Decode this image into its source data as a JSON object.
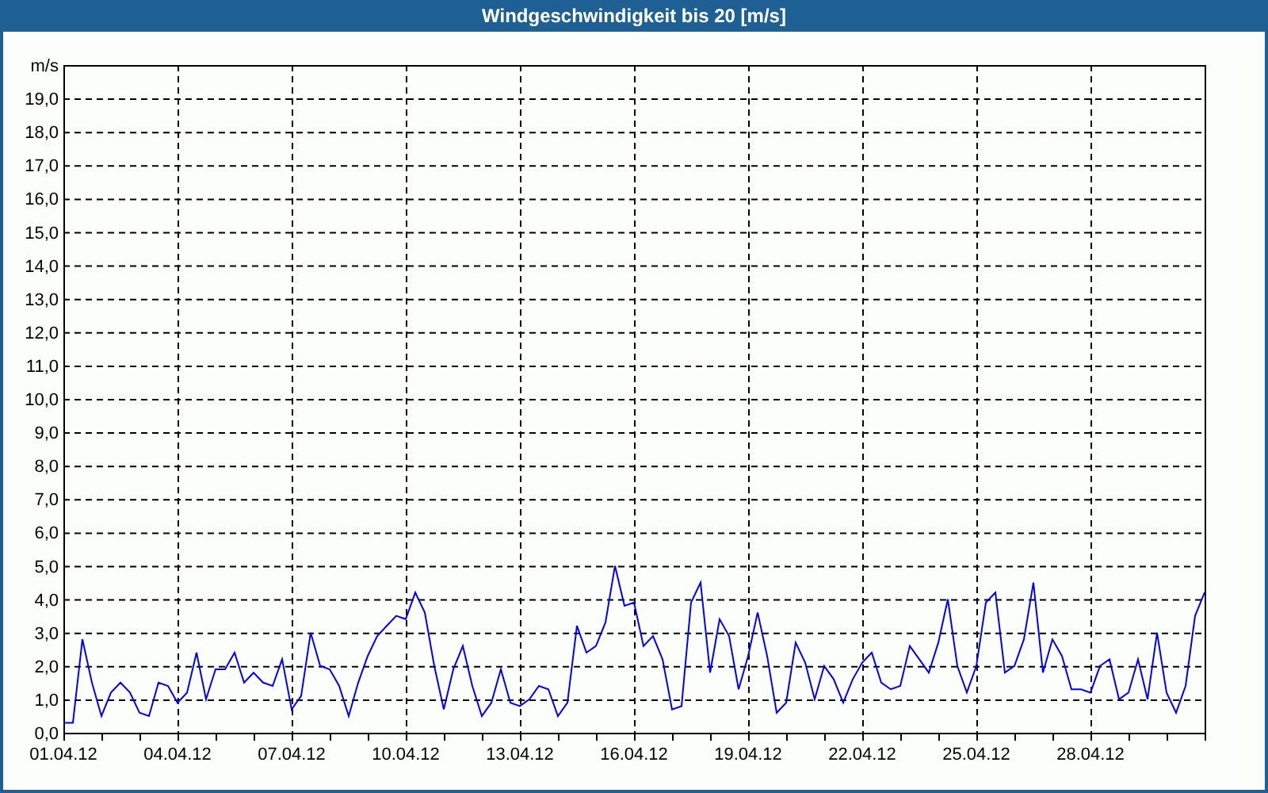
{
  "chart_data": {
    "type": "line",
    "grid": true,
    "ylabel": "m/s",
    "title": "Windgeschwindigkeit bis 20 [m/s]",
    "ylim": [
      0,
      20
    ],
    "categories": [
      "01.04.12",
      null,
      null,
      null,
      null,
      null,
      null,
      null,
      null,
      null,
      null,
      null,
      "04.04.12",
      null,
      null,
      null,
      null,
      null,
      null,
      null,
      null,
      null,
      null,
      null,
      "07.04.12",
      null,
      null,
      null,
      null,
      null,
      null,
      null,
      null,
      null,
      null,
      null,
      "10.04.12",
      null,
      null,
      null,
      null,
      null,
      null,
      null,
      null,
      null,
      null,
      null,
      "13.04.12",
      null,
      null,
      null,
      null,
      null,
      null,
      null,
      null,
      null,
      null,
      null,
      "16.04.12",
      null,
      null,
      null,
      null,
      null,
      null,
      null,
      null,
      null,
      null,
      null,
      "19.04.12",
      null,
      null,
      null,
      null,
      null,
      null,
      null,
      null,
      null,
      null,
      null,
      "22.04.12",
      null,
      null,
      null,
      null,
      null,
      null,
      null,
      null,
      null,
      null,
      null,
      "25.04.12",
      null,
      null,
      null,
      null,
      null,
      null,
      null,
      null,
      null,
      null,
      null,
      "28.04.12",
      null,
      null,
      null,
      null,
      null,
      null,
      null,
      null,
      null,
      null,
      null,
      null
    ],
    "series": [
      {
        "color": "#0000ff",
        "values": [
          0.3,
          0.3,
          2.8,
          1.5,
          0.5,
          1.2,
          1.5,
          1.2,
          0.6,
          0.5,
          1.5,
          1.4,
          0.9,
          1.2,
          2.4,
          1.0,
          1.9,
          1.9,
          2.4,
          1.5,
          1.8,
          1.5,
          1.4,
          2.2,
          0.7,
          1.1,
          3.0,
          2.0,
          1.9,
          1.4,
          0.5,
          1.5,
          2.3,
          2.9,
          3.2,
          3.5,
          3.4,
          4.2,
          3.6,
          2.0,
          0.7,
          1.9,
          2.6,
          1.4,
          0.5,
          0.9,
          1.9,
          0.9,
          0.8,
          1.0,
          1.4,
          1.3,
          0.5,
          0.9,
          3.2,
          2.4,
          2.6,
          3.3,
          5.0,
          3.8,
          3.9,
          2.6,
          2.9,
          2.2,
          0.7,
          0.8,
          3.9,
          4.5,
          1.8,
          3.4,
          2.9,
          1.3,
          2.3,
          3.6,
          2.3,
          0.6,
          0.9,
          2.7,
          2.1,
          1.0,
          2.0,
          1.6,
          0.9,
          1.6,
          2.1,
          2.4,
          1.5,
          1.3,
          1.4,
          2.6,
          2.2,
          1.8,
          2.7,
          4.0,
          2.0,
          1.2,
          2.0,
          3.9,
          4.2,
          1.8,
          2.0,
          2.8,
          4.5,
          1.8,
          2.8,
          2.3,
          1.3,
          1.3,
          1.2,
          2.0,
          2.2,
          1.0,
          1.2,
          2.2,
          1.0,
          3.0,
          1.2,
          0.6,
          1.4,
          3.5,
          4.2
        ]
      }
    ],
    "yticks": [
      {
        "value": 0,
        "label": "0,0"
      },
      {
        "value": 1,
        "label": "1,0"
      },
      {
        "value": 2,
        "label": "2,0"
      },
      {
        "value": 3,
        "label": "3,0"
      },
      {
        "value": 4,
        "label": "4,0"
      },
      {
        "value": 5,
        "label": "5,0"
      },
      {
        "value": 6,
        "label": "6,0"
      },
      {
        "value": 7,
        "label": "7,0"
      },
      {
        "value": 8,
        "label": "8,0"
      },
      {
        "value": 9,
        "label": "9,0"
      },
      {
        "value": 10,
        "label": "10,0"
      },
      {
        "value": 11,
        "label": "11,0"
      },
      {
        "value": 12,
        "label": "12,0"
      },
      {
        "value": 13,
        "label": "13,0"
      },
      {
        "value": 14,
        "label": "14,0"
      },
      {
        "value": 15,
        "label": "15,0"
      },
      {
        "value": 16,
        "label": "16,0"
      },
      {
        "value": 17,
        "label": "17,0"
      },
      {
        "value": 18,
        "label": "18,0"
      },
      {
        "value": 19,
        "label": "19,0"
      }
    ]
  }
}
